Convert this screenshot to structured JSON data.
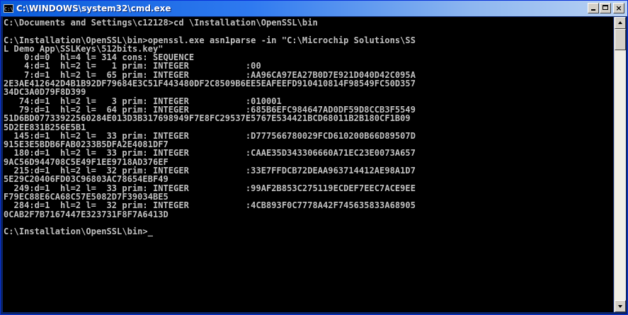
{
  "window": {
    "title": "C:\\WINDOWS\\system32\\cmd.exe",
    "icon": "cmd-icon",
    "controls": {
      "minimize": "minimize-icon",
      "maximize": "maximize-icon",
      "close": "close-icon",
      "close_label": "×"
    }
  },
  "console": {
    "lines": [
      "C:\\Documents and Settings\\c12128>cd \\Installation\\OpenSSL\\bin",
      "",
      "C:\\Installation\\OpenSSL\\bin>openssl.exe asn1parse -in \"C:\\Microchip Solutions\\SS",
      "L Demo App\\SSLKeys\\512bits.key\"",
      "    0:d=0  hl=4 l= 314 cons: SEQUENCE",
      "    4:d=1  hl=2 l=   1 prim: INTEGER           :00",
      "    7:d=1  hl=2 l=  65 prim: INTEGER           :AA96CA97EA27B0D7E921D040D42C095A",
      "2E3AE412642D4B1B92DF79684E3C51F443480DF2C8509B6EE5EAFEEFD910410814F98549FC50D357",
      "34DC3A0D79F8D399",
      "   74:d=1  hl=2 l=   3 prim: INTEGER           :010001",
      "   79:d=1  hl=2 l=  64 prim: INTEGER           :685B6EFC984647AD0DF59D8CCB3F5549",
      "51D6BD07733922560284E013D3B317698949F7E8FC29537E5767E534421BCD68011B2B180CF1B09",
      "5D2EE831B256E5B1",
      "  145:d=1  hl=2 l=  33 prim: INTEGER           :D777566780029FCD610200B66D89507D",
      "915E3E5BDB6FAB0233B5DFA2E4081DF7",
      "  180:d=1  hl=2 l=  33 prim: INTEGER           :CAAE35D343306660A71EC23E0073A657",
      "9AC56D944708C5E49F1EE9718AD376EF",
      "  215:d=1  hl=2 l=  32 prim: INTEGER           :33E7FFDCB72DEAA963714412AE98A1D7",
      "5E29C20406FD03C96803AC78654EBF49",
      "  249:d=1  hl=2 l=  33 prim: INTEGER           :99AF2B853C275119ECDEF7EEC7ACE9EE",
      "F79EC88E6CA68C57E5082D7F39034BE5",
      "  284:d=1  hl=2 l=  32 prim: INTEGER           :4CB893F0C7778A42F745635833A68905",
      "0CAB2F7B7167447E323731F8F7A6413D",
      "",
      "C:\\Installation\\OpenSSL\\bin>_"
    ]
  },
  "scrollbar": {
    "up": "scroll-up-arrow-icon",
    "down": "scroll-down-arrow-icon"
  }
}
